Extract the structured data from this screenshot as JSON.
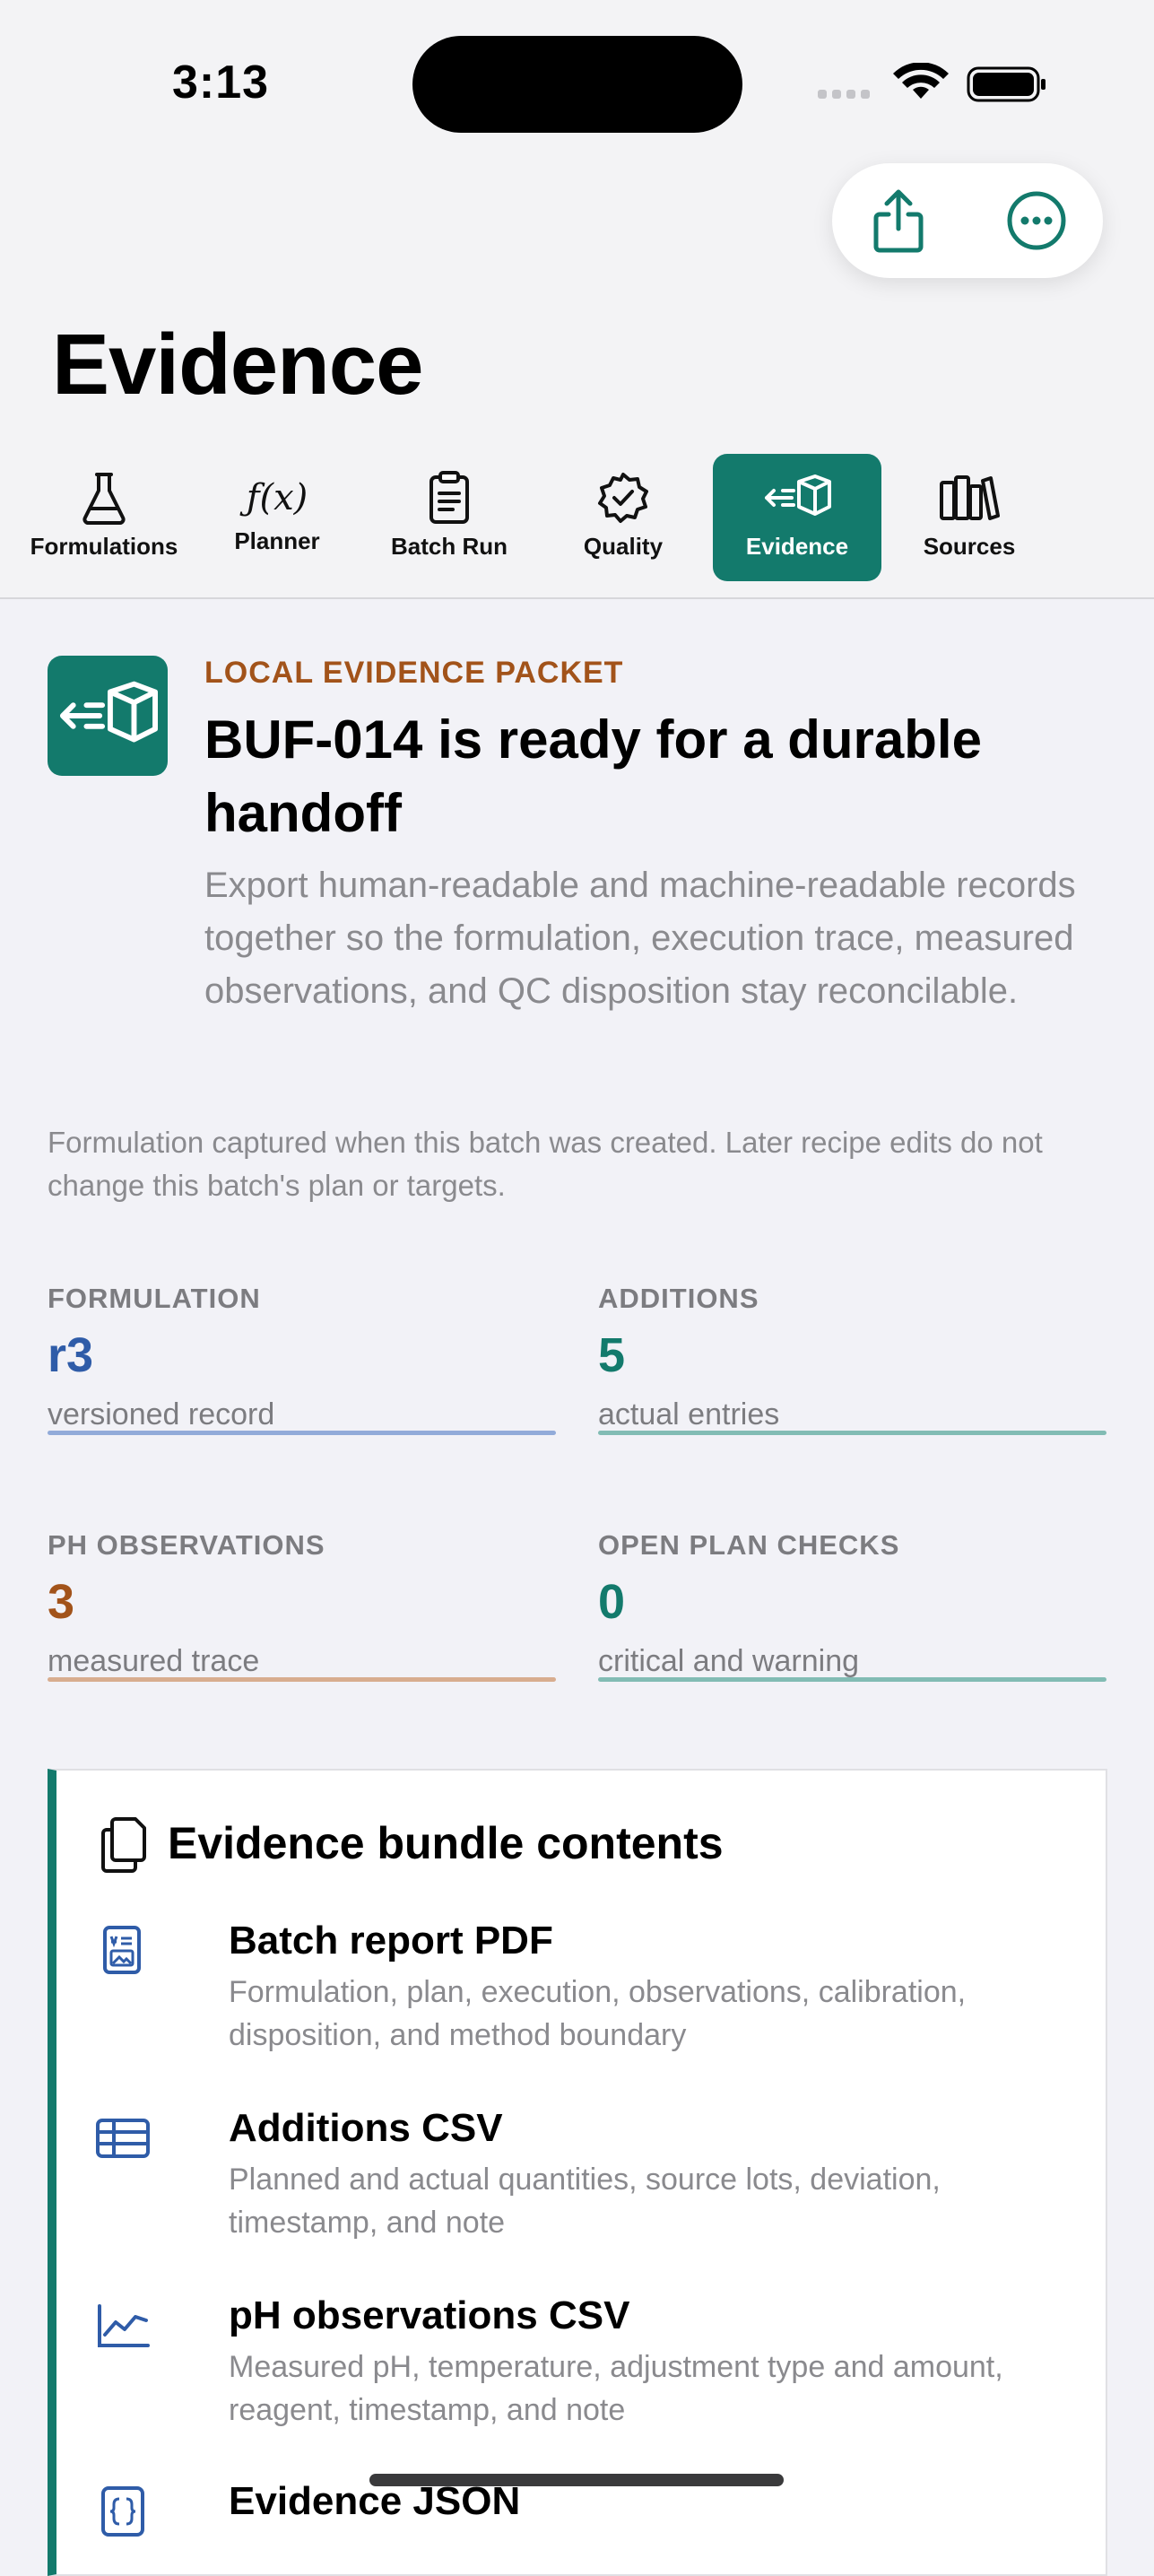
{
  "status": {
    "time": "3:13"
  },
  "nav": {
    "share_icon": "share-icon",
    "more_icon": "ellipsis-circle-icon"
  },
  "page": {
    "title": "Evidence"
  },
  "tabs": [
    {
      "label": "Formulations",
      "icon": "flask-icon"
    },
    {
      "label": "Planner",
      "icon": "function-icon"
    },
    {
      "label": "Batch Run",
      "icon": "clipboard-icon"
    },
    {
      "label": "Quality",
      "icon": "checkmark-seal-icon"
    },
    {
      "label": "Evidence",
      "icon": "shipping-box-icon",
      "active": true
    },
    {
      "label": "Sources",
      "icon": "books-icon"
    }
  ],
  "hero": {
    "eyebrow": "LOCAL EVIDENCE PACKET",
    "title": "BUF-014 is ready for a durable handoff",
    "description": "Export human-readable and machine-readable records together so the formulation, execution trace, measured observations, and QC disposition stay reconcilable."
  },
  "note": "Formulation captured when this batch was created. Later recipe edits do not change this batch's plan or targets.",
  "stats": [
    {
      "label": "FORMULATION",
      "value": "r3",
      "sub": "versioned record",
      "color": "#2f5ca8",
      "bar_color": "#92abd9"
    },
    {
      "label": "ADDITIONS",
      "value": "5",
      "sub": "actual entries",
      "color": "#137a6c",
      "bar_color": "#82bcb4"
    },
    {
      "label": "PH OBSERVATIONS",
      "value": "3",
      "sub": "measured trace",
      "color": "#a2531a",
      "bar_color": "#d8ad8f"
    },
    {
      "label": "OPEN PLAN CHECKS",
      "value": "0",
      "sub": "critical and warning",
      "color": "#137a6c",
      "bar_color": "#82bcb4"
    }
  ],
  "bundle": {
    "title": "Evidence bundle contents",
    "items": [
      {
        "title": "Batch report PDF",
        "desc": "Formulation, plan, execution, observations, calibration, disposition, and method boundary",
        "icon": "document-richtext-icon"
      },
      {
        "title": "Additions CSV",
        "desc": "Planned and actual quantities, source lots, deviation, timestamp, and note",
        "icon": "table-icon"
      },
      {
        "title": "pH observations CSV",
        "desc": "Measured pH, temperature, adjustment type and amount, reagent, timestamp, and note",
        "icon": "line-chart-icon"
      },
      {
        "title": "Evidence JSON",
        "desc": "",
        "icon": "curlybraces-icon"
      }
    ]
  }
}
